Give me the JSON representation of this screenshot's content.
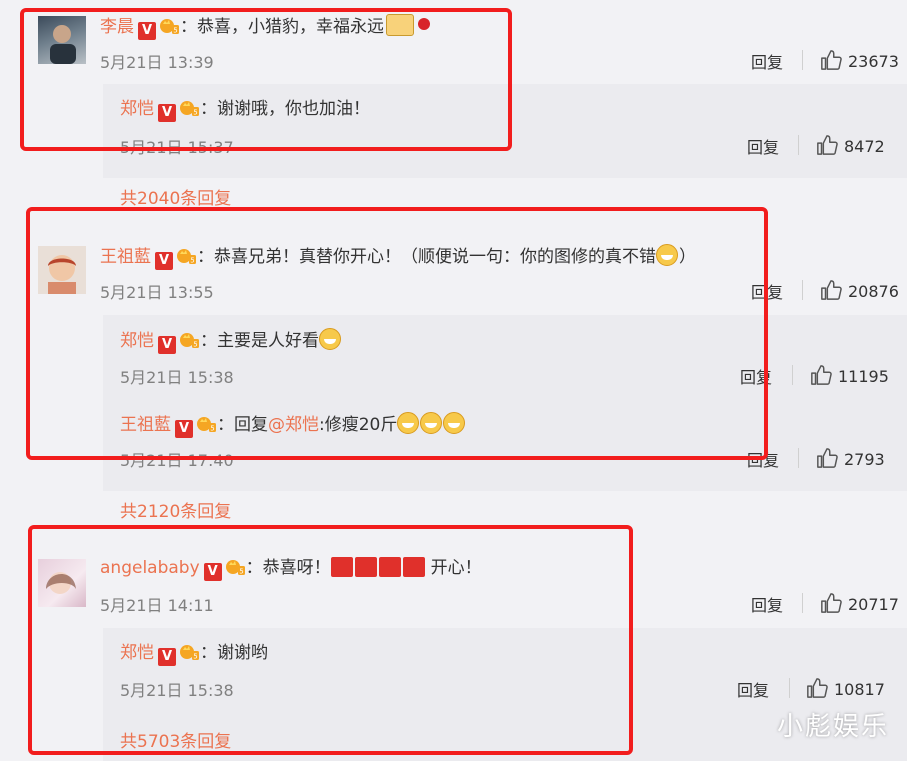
{
  "comments": [
    {
      "user": "李晨",
      "text": "：恭喜，小猎豹，幸福永远",
      "time": "5月21日 13:39",
      "reply_label": "回复",
      "likes": "23673",
      "replies": [
        {
          "user": "郑恺",
          "text": "：谢谢哦，你也加油！",
          "time": "5月21日 15:37",
          "reply_label": "回复",
          "likes": "8472"
        }
      ],
      "more": "共2040条回复"
    },
    {
      "user": "王祖藍",
      "text": "：恭喜兄弟！真替你开心！（顺便说一句：你的图修的真不错",
      "text_end": "）",
      "time": "5月21日 13:55",
      "reply_label": "回复",
      "likes": "20876",
      "replies": [
        {
          "user": "郑恺",
          "text": "：主要是人好看",
          "time": "5月21日 15:38",
          "reply_label": "回复",
          "likes": "11195"
        },
        {
          "user": "王祖藍",
          "text_prefix": "：回复",
          "mention": "@郑恺",
          "text": ":修瘦20斤",
          "time": "5月21日 17:40",
          "reply_label": "回复",
          "likes": "2793"
        }
      ],
      "more": "共2120条回复"
    },
    {
      "user": "angelababy",
      "text": "：恭喜呀！",
      "text_end": "开心！",
      "time": "5月21日 14:11",
      "reply_label": "回复",
      "likes": "20717",
      "replies": [
        {
          "user": "郑恺",
          "text": "：谢谢哟",
          "time": "5月21日 15:38",
          "reply_label": "回复",
          "likes": "10817"
        }
      ],
      "more": "共5703条回复"
    }
  ],
  "badge_v": "V",
  "watermark": "小彪娱乐",
  "colors": {
    "username": "#eb7350",
    "highlight_box": "#f21d1d",
    "background": "#f2f2f5",
    "reply_bg": "#ebebef"
  }
}
